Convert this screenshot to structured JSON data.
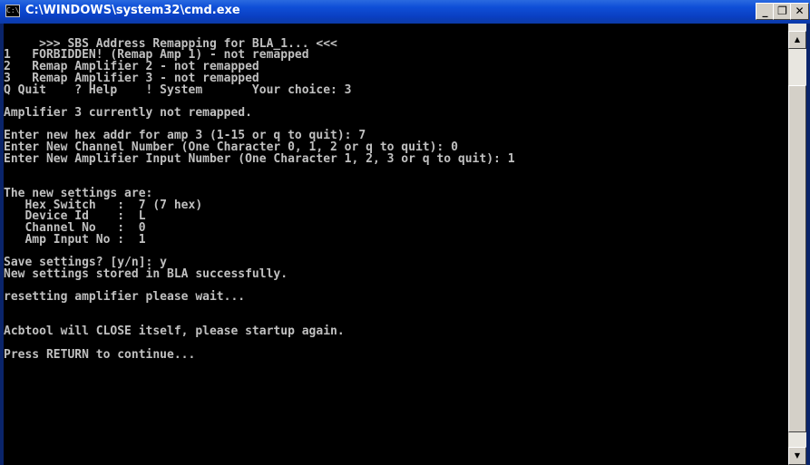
{
  "window": {
    "title": "C:\\WINDOWS\\system32\\cmd.exe",
    "icon": "cmd-icon",
    "icon_glyph": "C:\\",
    "buttons": {
      "minimize": "_",
      "maximize": "❐",
      "close": "✕"
    }
  },
  "console": {
    "lines": [
      "",
      "     >>> SBS Address Remapping for BLA_1... <<<",
      "1   FORBIDDEN! (Remap Amp 1) - not remapped",
      "2   Remap Amplifier 2 - not remapped",
      "3   Remap Amplifier 3 - not remapped",
      "Q Quit    ? Help    ! System       Your choice: 3",
      "",
      "Amplifier 3 currently not remapped.",
      "",
      "Enter new hex addr for amp 3 (1-15 or q to quit): 7",
      "Enter New Channel Number (One Character 0, 1, 2 or q to quit): 0",
      "Enter New Amplifier Input Number (One Character 1, 2, 3 or q to quit): 1",
      "",
      "",
      "The new settings are:",
      "   Hex Switch   :  7 (7 hex)",
      "   Device Id    :  L",
      "   Channel No   :  0",
      "   Amp Input No :  1",
      "",
      "Save settings? [y/n]: y",
      "New settings stored in BLA successfully.",
      "",
      "resetting amplifier please wait...",
      "",
      "",
      "Acbtool will CLOSE itself, please startup again.",
      "",
      "Press RETURN to continue..."
    ]
  },
  "scrollbar": {
    "up_icon": "scroll-up-arrow-icon",
    "down_icon": "scroll-down-arrow-icon",
    "up_glyph": "▲",
    "down_glyph": "▼"
  },
  "colors": {
    "title_bar": "#0a3fc2",
    "console_bg": "#000000",
    "console_text": "#c0c0c0"
  }
}
